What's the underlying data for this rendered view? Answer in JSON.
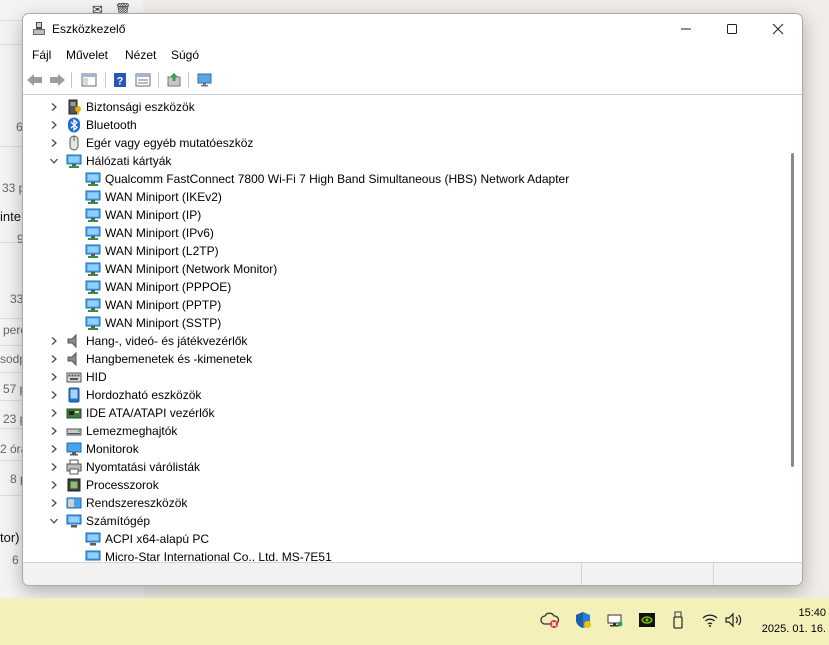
{
  "background_app": {
    "snippets": [
      {
        "text": "6",
        "cls": ""
      },
      {
        "text": "33 p",
        "cls": ""
      },
      {
        "text": "inte",
        "cls": "dark"
      },
      {
        "text": "9",
        "cls": ""
      },
      {
        "text": "33",
        "cls": ""
      },
      {
        "text": "perc",
        "cls": ""
      },
      {
        "text": "sodp",
        "cls": ""
      },
      {
        "text": "57 p",
        "cls": ""
      },
      {
        "text": "23 p",
        "cls": ""
      },
      {
        "text": "2 órá",
        "cls": ""
      },
      {
        "text": "8 p",
        "cls": ""
      },
      {
        "text": "tor)",
        "cls": "dark"
      },
      {
        "text": "6",
        "cls": ""
      }
    ]
  },
  "window": {
    "title": "Eszközkezelő",
    "controls": {
      "minimize": "minimize",
      "maximize": "maximize",
      "close": "close"
    }
  },
  "menu": [
    "Fájl",
    "Művelet",
    "Nézet",
    "Súgó"
  ],
  "toolbar": {
    "buttons": [
      "back-arrow",
      "forward-arrow",
      "show-hide-tree",
      "help",
      "properties",
      "update-driver",
      "scan-hardware"
    ]
  },
  "tree": [
    {
      "label": "Biztonsági eszközök",
      "level": 0,
      "state": "collapsed",
      "icon": "security-device-icon"
    },
    {
      "label": "Bluetooth",
      "level": 0,
      "state": "collapsed",
      "icon": "bluetooth-icon"
    },
    {
      "label": "Egér vagy egyéb mutatóeszköz",
      "level": 0,
      "state": "collapsed",
      "icon": "mouse-icon"
    },
    {
      "label": "Hálózati kártyák",
      "level": 0,
      "state": "expanded",
      "icon": "network-adapter-icon"
    },
    {
      "label": "Qualcomm FastConnect 7800 Wi-Fi 7 High Band Simultaneous (HBS) Network Adapter",
      "level": 1,
      "state": "leaf",
      "icon": "network-adapter-icon"
    },
    {
      "label": "WAN Miniport (IKEv2)",
      "level": 1,
      "state": "leaf",
      "icon": "network-adapter-icon"
    },
    {
      "label": "WAN Miniport (IP)",
      "level": 1,
      "state": "leaf",
      "icon": "network-adapter-icon"
    },
    {
      "label": "WAN Miniport (IPv6)",
      "level": 1,
      "state": "leaf",
      "icon": "network-adapter-icon"
    },
    {
      "label": "WAN Miniport (L2TP)",
      "level": 1,
      "state": "leaf",
      "icon": "network-adapter-icon"
    },
    {
      "label": "WAN Miniport (Network Monitor)",
      "level": 1,
      "state": "leaf",
      "icon": "network-adapter-icon"
    },
    {
      "label": "WAN Miniport (PPPOE)",
      "level": 1,
      "state": "leaf",
      "icon": "network-adapter-icon"
    },
    {
      "label": "WAN Miniport (PPTP)",
      "level": 1,
      "state": "leaf",
      "icon": "network-adapter-icon"
    },
    {
      "label": "WAN Miniport (SSTP)",
      "level": 1,
      "state": "leaf",
      "icon": "network-adapter-icon"
    },
    {
      "label": "Hang-, videó- és játékvezérlők",
      "level": 0,
      "state": "collapsed",
      "icon": "speaker-icon"
    },
    {
      "label": "Hangbemenetek és -kimenetek",
      "level": 0,
      "state": "collapsed",
      "icon": "speaker-icon"
    },
    {
      "label": "HID",
      "level": 0,
      "state": "collapsed",
      "icon": "hid-icon"
    },
    {
      "label": "Hordozható eszközök",
      "level": 0,
      "state": "collapsed",
      "icon": "portable-device-icon"
    },
    {
      "label": "IDE ATA/ATAPI vezérlők",
      "level": 0,
      "state": "collapsed",
      "icon": "ide-controller-icon"
    },
    {
      "label": "Lemezmeghajtók",
      "level": 0,
      "state": "collapsed",
      "icon": "disk-drive-icon"
    },
    {
      "label": "Monitorok",
      "level": 0,
      "state": "collapsed",
      "icon": "monitor-icon"
    },
    {
      "label": "Nyomtatási várólisták",
      "level": 0,
      "state": "collapsed",
      "icon": "printer-icon"
    },
    {
      "label": "Processzorok",
      "level": 0,
      "state": "collapsed",
      "icon": "processor-icon"
    },
    {
      "label": "Rendszereszközök",
      "level": 0,
      "state": "collapsed",
      "icon": "system-device-icon"
    },
    {
      "label": "Számítógép",
      "level": 0,
      "state": "expanded",
      "icon": "computer-icon"
    },
    {
      "label": "ACPI x64-alapú PC",
      "level": 1,
      "state": "leaf",
      "icon": "computer-icon"
    },
    {
      "label": "Micro-Star International Co., Ltd. MS-7E51",
      "level": 1,
      "state": "leaf",
      "icon": "computer-icon"
    }
  ],
  "taskbar": {
    "tray_icons": [
      "cloud-error-icon",
      "windows-security-icon",
      "network-device-icon",
      "nvidia-icon",
      "usb-drive-icon",
      "wifi-icon",
      "volume-icon"
    ],
    "time": "15:40",
    "date": "2025. 01. 16."
  },
  "colors": {
    "accent": "#2a7fd4",
    "taskbar": "#f3f0b9",
    "selection": "#cce8ff"
  }
}
